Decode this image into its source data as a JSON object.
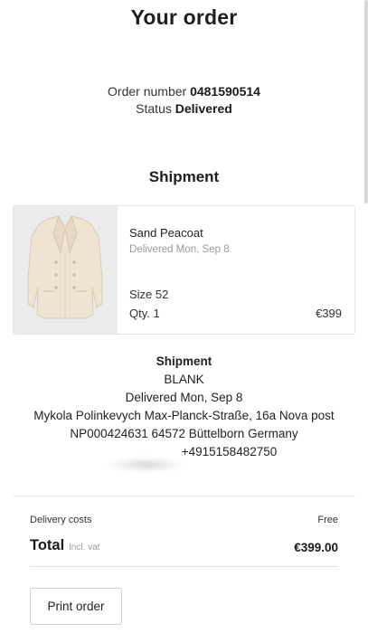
{
  "page": {
    "title": "Your order"
  },
  "order": {
    "number_label": "Order number",
    "number": "0481590514",
    "status_label": "Status",
    "status": "Delivered"
  },
  "shipment_heading": "Shipment",
  "product": {
    "name": "Sand Peacoat",
    "delivered": "Delivered Mon, Sep 8",
    "size": "Size 52",
    "qty": "Qty. 1",
    "price": "€399",
    "image_icon": "peacoat-image"
  },
  "shipment": {
    "label": "Shipment",
    "carrier": "BLANK",
    "delivered": "Delivered Mon, Sep 8",
    "address_line1": "Mykola Polinkevych Max-Planck-Straße, 16a Nova post",
    "address_line2": "NP000424631 64572 Büttelborn Germany",
    "phone": "+4915158482750"
  },
  "summary": {
    "delivery_label": "Delivery costs",
    "delivery_value": "Free",
    "total_label": "Total",
    "total_sub": "Incl. vat",
    "total_value": "€399.00"
  },
  "actions": {
    "print_label": "Print order"
  },
  "colors": {
    "text": "#1f1f1f",
    "muted": "#9a9a9a",
    "border": "#e3e3e3",
    "image_bg": "#ececec",
    "coat": "#efe3d2"
  }
}
